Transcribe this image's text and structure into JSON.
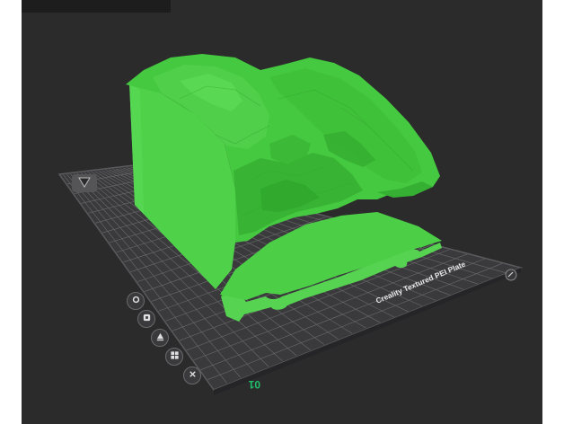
{
  "viewport": {
    "plate_label": "Creality Textured PEI Plate",
    "plate_number": "01",
    "model_color": "#4fd14a",
    "plate_color": "#3a3a3c",
    "grid_color": "#6b6b6e",
    "background_color": "#2b2b2c",
    "accent_color": "#1fbf6a"
  },
  "toolbar": {
    "buttons": [
      {
        "icon": "settings-icon"
      },
      {
        "icon": "filament-icon"
      },
      {
        "icon": "auto-orient-icon"
      },
      {
        "icon": "arrange-icon"
      },
      {
        "icon": "close-icon"
      }
    ]
  }
}
